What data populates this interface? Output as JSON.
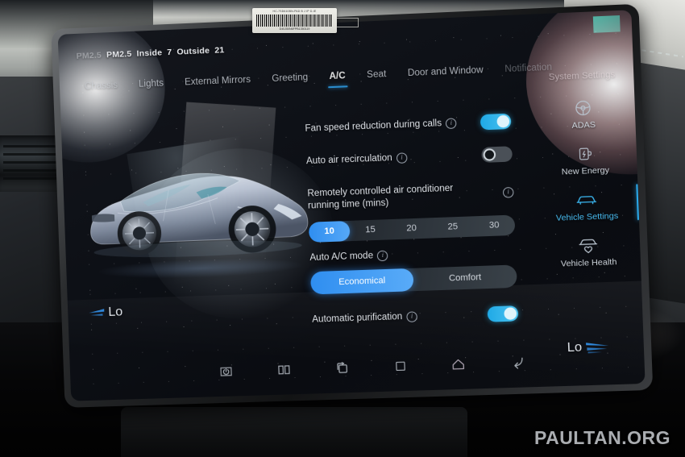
{
  "status": {
    "pm_label": "PM2.5",
    "inside_label": "Inside",
    "inside_value": "7",
    "outside_label": "Outside",
    "outside_value": "21",
    "hidden_prefix": "PM2.5"
  },
  "tabs": [
    {
      "label": "Chassis",
      "active": false,
      "faded": true
    },
    {
      "label": "Lights",
      "active": false,
      "faded": false
    },
    {
      "label": "External Mirrors",
      "active": false,
      "faded": false
    },
    {
      "label": "Greeting",
      "active": false,
      "faded": false
    },
    {
      "label": "A/C",
      "active": true,
      "faded": false
    },
    {
      "label": "Seat",
      "active": false,
      "faded": false
    },
    {
      "label": "Door and Window",
      "active": false,
      "faded": false
    },
    {
      "label": "Notification",
      "active": false,
      "faded": true
    }
  ],
  "settings": {
    "fan_speed": {
      "label": "Fan speed reduction during calls",
      "state": "on"
    },
    "recirculation": {
      "label": "Auto air recirculation",
      "state": "off"
    },
    "remote_ac": {
      "label": "Remotely controlled air conditioner running time (mins)",
      "options": [
        "10",
        "15",
        "20",
        "25",
        "30"
      ],
      "selected": "10"
    },
    "auto_ac_mode": {
      "label": "Auto A/C mode",
      "options": [
        "Economical",
        "Comfort"
      ],
      "selected": "Economical"
    },
    "purification": {
      "label": "Automatic purification",
      "state": "on"
    },
    "info_glyph": "i"
  },
  "sidebar": {
    "title": "System Settings",
    "items": [
      {
        "label": "ADAS",
        "icon": "steering-wheel-icon",
        "active": false
      },
      {
        "label": "New Energy",
        "icon": "battery-charge-icon",
        "active": false
      },
      {
        "label": "Vehicle Settings",
        "icon": "car-icon",
        "active": true
      },
      {
        "label": "Vehicle Health",
        "icon": "car-heart-icon",
        "active": false
      }
    ]
  },
  "climate": {
    "left_temp": "Lo",
    "right_temp": "Lo"
  },
  "navbar": [
    {
      "name": "power-icon"
    },
    {
      "name": "split-screen-icon"
    },
    {
      "name": "app-switch-icon"
    },
    {
      "name": "recents-square-icon"
    },
    {
      "name": "home-icon"
    },
    {
      "name": "back-icon"
    }
  ],
  "sticker": {
    "top_text": "HC-7SD610BN-PAD B J IP D-IE",
    "bottom_text": "D40J50N6FPB1350119"
  },
  "watermark": "PAULTAN.ORG",
  "colors": {
    "accent_blue": "#2f8ef0",
    "toggle_on": "#1fa9e6",
    "active_tab_underline": "#2e9fe8",
    "sidebar_active": "#49bdf2",
    "screen_bg": "#0d1016"
  }
}
